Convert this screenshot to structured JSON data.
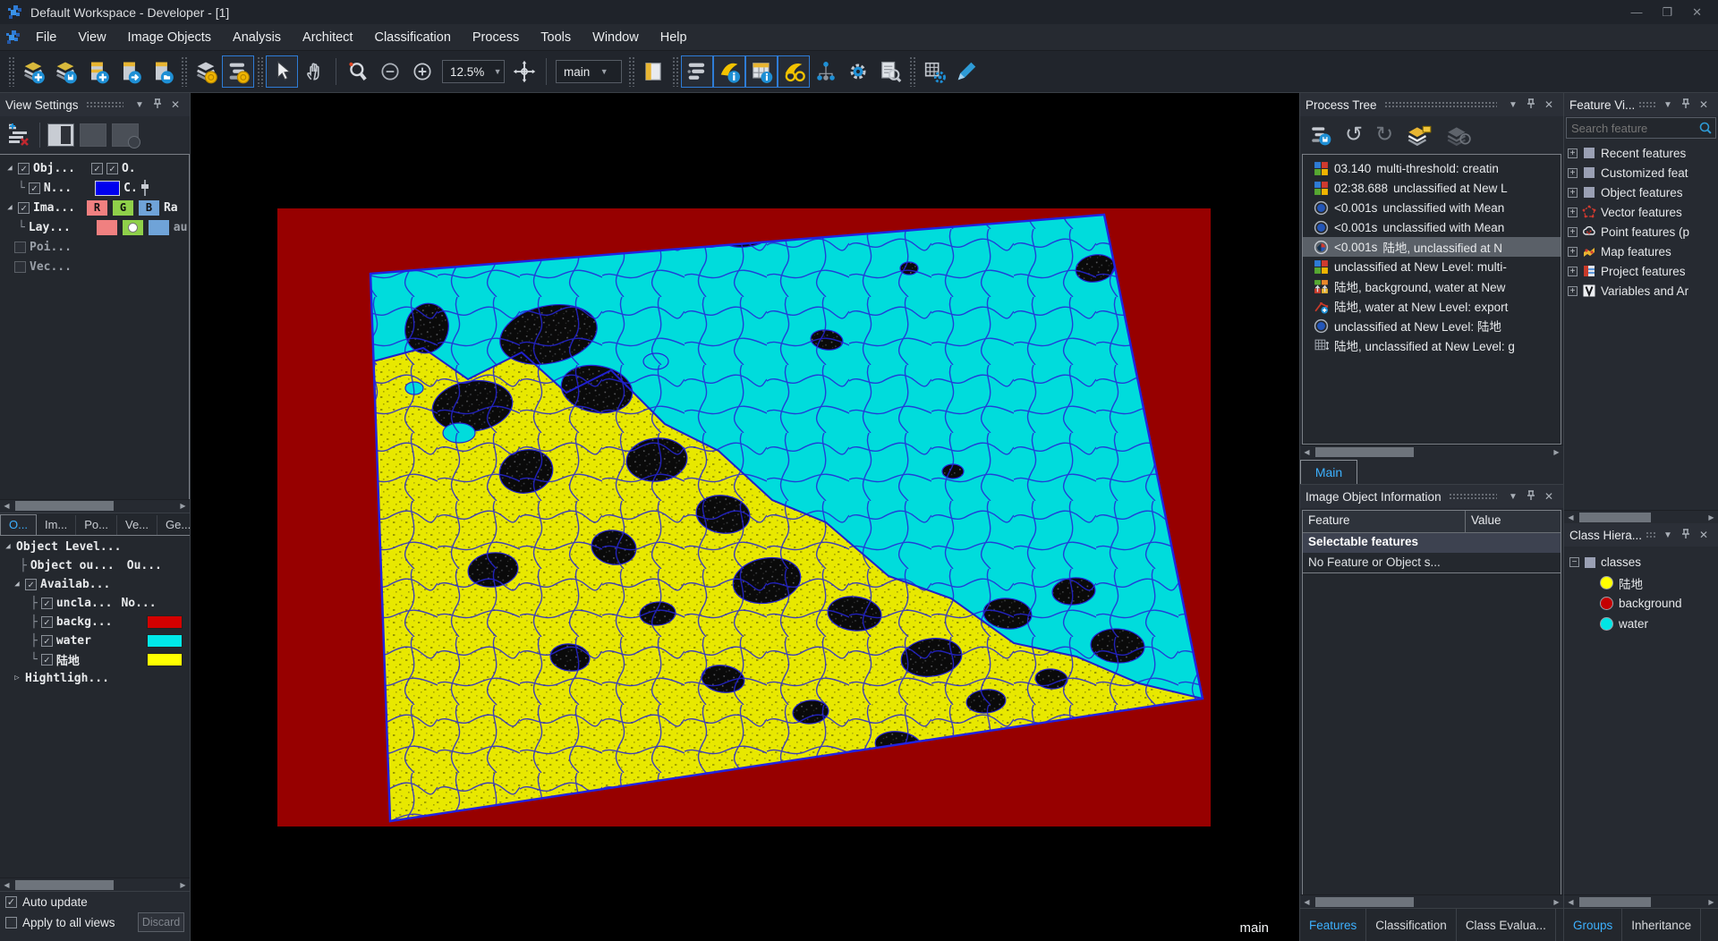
{
  "window": {
    "title": "Default Workspace - Developer - [1]"
  },
  "menu": {
    "items": [
      "File",
      "View",
      "Image Objects",
      "Analysis",
      "Architect",
      "Classification",
      "Process",
      "Tools",
      "Window",
      "Help"
    ]
  },
  "toolbar": {
    "zoom_value": "12.5%",
    "map_value": "main"
  },
  "colors": {
    "accent_blue": "#2e9bd6",
    "active_tab_text": "#3db1ff",
    "class_land": "#ffff00",
    "class_background": "#c40000",
    "class_water": "#00e5e5",
    "segment_line": "#2424d6",
    "canvas_backdrop": "#970000",
    "water_fill": "#00dcdc",
    "land_fill": "#e8e800"
  },
  "view_settings": {
    "title": "View Settings",
    "rows": {
      "r1": {
        "label": "Obj...",
        "extra": "O."
      },
      "r2": {
        "label": "N...",
        "extra": "C."
      },
      "r3": {
        "label": "Ima...",
        "c1": "R",
        "c2": "G",
        "c3": "B",
        "extra": "Ra"
      },
      "r4": {
        "label": "Lay...",
        "extra": "au"
      },
      "r5": {
        "label": "Poi..."
      },
      "r6": {
        "label": "Vec..."
      }
    },
    "tabs": [
      "O...",
      "Im...",
      "Po...",
      "Ve...",
      "Ge..."
    ],
    "levels": {
      "r1": "Object Level...",
      "r2a": "Object ou...",
      "r2b": "Ou...",
      "r3": "Availab...",
      "r4a": "uncla...",
      "r4b": "No...",
      "r5": "backg...",
      "r6": "water",
      "r7": "陆地",
      "r8": "Hightligh..."
    },
    "auto_update": "Auto update",
    "apply_all": "Apply to all views",
    "discard": "Discard"
  },
  "viewer": {
    "map_label": "main"
  },
  "process_tree": {
    "title": "Process Tree",
    "tab": "Main",
    "items": [
      {
        "time": "03.140",
        "text": "multi-threshold: creatin"
      },
      {
        "time": "02:38.688",
        "text": "unclassified at  New L"
      },
      {
        "time": "<0.001s",
        "text": "unclassified with Mean"
      },
      {
        "time": "<0.001s",
        "text": "unclassified with Mean"
      },
      {
        "time": "<0.001s",
        "text": "陆地, unclassified at  N"
      },
      {
        "time": "",
        "text": "unclassified at  New Level: multi-"
      },
      {
        "time": "",
        "text": "陆地, background, water at  New"
      },
      {
        "time": "",
        "text": "陆地, water at  New Level: export"
      },
      {
        "time": "",
        "text": "unclassified at  New Level: 陆地"
      },
      {
        "time": "",
        "text": "陆地, unclassified at  New Level: g"
      }
    ]
  },
  "image_object_info": {
    "title": "Image Object Information",
    "col_feature": "Feature",
    "col_value": "Value",
    "group_row": "Selectable features",
    "empty_row": "No Feature or Object s...",
    "tabs": [
      "Features",
      "Classification",
      "Class Evalua..."
    ]
  },
  "feature_view": {
    "title": "Feature Vi...",
    "search_placeholder": "Search feature",
    "items": [
      "Recent features",
      "Customized feat",
      "Object features",
      "Vector features",
      "Point features (p",
      "Map features",
      "Project features",
      "Variables and Ar"
    ]
  },
  "class_hierarchy": {
    "title": "Class Hiera...",
    "root": "classes",
    "items": [
      {
        "name": "陆地",
        "color": "#ffff00"
      },
      {
        "name": "background",
        "color": "#c40000"
      },
      {
        "name": "water",
        "color": "#00e5e5"
      }
    ],
    "tabs": [
      "Groups",
      "Inheritance"
    ]
  }
}
